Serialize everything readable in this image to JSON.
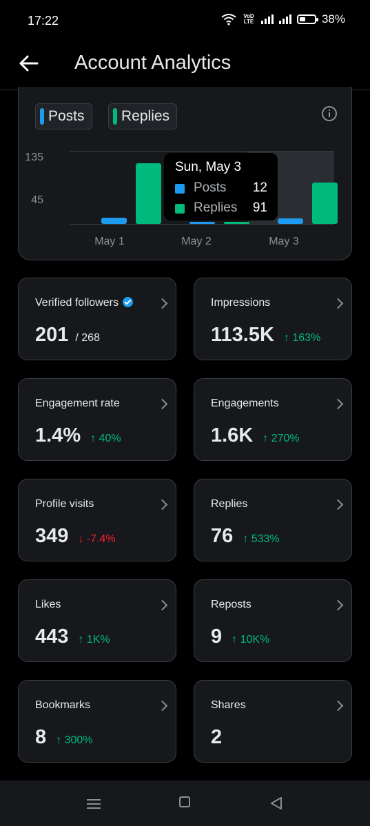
{
  "status_bar": {
    "time": "17:22",
    "network_top": "VoD",
    "network_bottom": "LTE",
    "battery": "38%"
  },
  "header": {
    "title": "Account Analytics",
    "back_icon": "arrow-left-icon"
  },
  "chart": {
    "legend": [
      {
        "label": "Posts",
        "color": "#1d9bf0"
      },
      {
        "label": "Replies",
        "color": "#00ba7c"
      }
    ],
    "info_icon": "info-icon",
    "tooltip": {
      "date": "Sun, May 3",
      "posts_label": "Posts",
      "posts_value": "12",
      "replies_label": "Replies",
      "replies_value": "91"
    },
    "chart_data": {
      "type": "bar",
      "categories": [
        "May 1",
        "May 2",
        "May 3"
      ],
      "series": [
        {
          "name": "Posts",
          "values": [
            14,
            5,
            12
          ]
        },
        {
          "name": "Replies",
          "values": [
            134,
            5,
            91
          ]
        }
      ],
      "yticks": [
        "135",
        "45"
      ],
      "ylim": [
        0,
        160
      ],
      "highlighted_category": "May 3"
    }
  },
  "metrics": [
    {
      "label": "Verified followers",
      "value": "201",
      "sub": "/ 268",
      "verified": true
    },
    {
      "label": "Impressions",
      "value": "113.5K",
      "change": "↑ 163%",
      "trend": "up"
    },
    {
      "label": "Engagement rate",
      "value": "1.4%",
      "change": "↑ 40%",
      "trend": "up"
    },
    {
      "label": "Engagements",
      "value": "1.6K",
      "change": "↑ 270%",
      "trend": "up"
    },
    {
      "label": "Profile visits",
      "value": "349",
      "change": "↓ -7.4%",
      "trend": "down"
    },
    {
      "label": "Replies",
      "value": "76",
      "change": "↑ 533%",
      "trend": "up"
    },
    {
      "label": "Likes",
      "value": "443",
      "change": "↑ 1K%",
      "trend": "up"
    },
    {
      "label": "Reposts",
      "value": "9",
      "change": "↑ 10K%",
      "trend": "up"
    },
    {
      "label": "Bookmarks",
      "value": "8",
      "change": "↑ 300%",
      "trend": "up"
    },
    {
      "label": "Shares",
      "value": "2",
      "change": "",
      "trend": "none"
    }
  ],
  "colors": {
    "up": "#00ba7c",
    "down": "#f4212e",
    "posts": "#1d9bf0",
    "replies": "#00ba7c"
  },
  "nav_bar": {
    "icons": [
      "menu-icon",
      "home-icon",
      "back-triangle-icon"
    ]
  }
}
